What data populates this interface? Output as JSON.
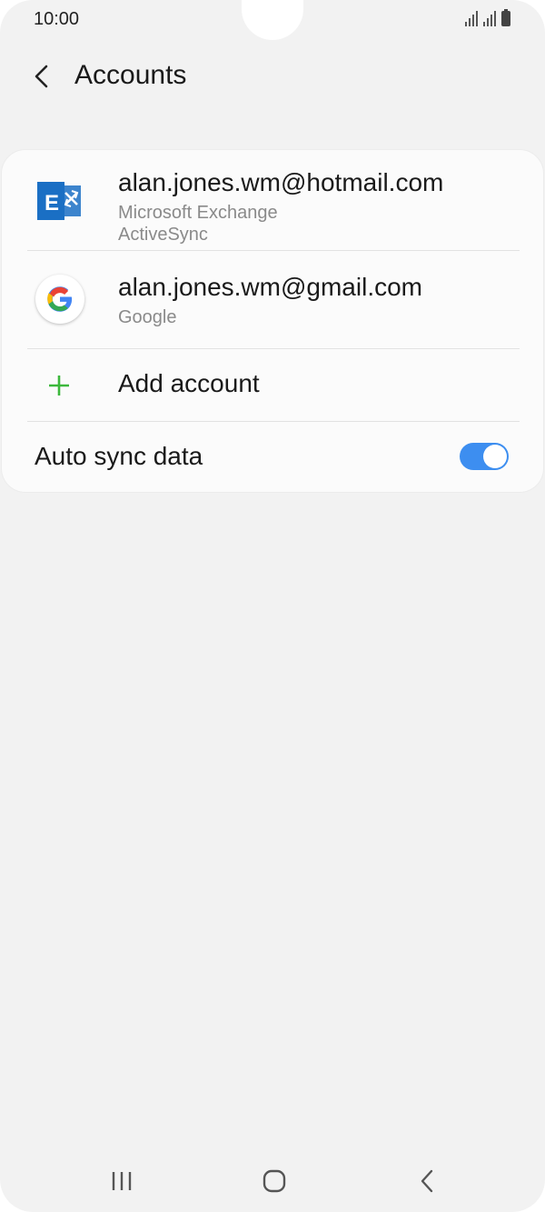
{
  "status_bar": {
    "time": "10:00"
  },
  "header": {
    "title": "Accounts",
    "back_icon": "chevron-left-icon"
  },
  "accounts": [
    {
      "email": "alan.jones.wm@hotmail.com",
      "type_line1": "Microsoft Exchange",
      "type_line2": "ActiveSync",
      "icon": "exchange-icon"
    },
    {
      "email": "alan.jones.wm@gmail.com",
      "type_line1": "Google",
      "icon": "google-icon"
    }
  ],
  "add_account": {
    "label": "Add account",
    "icon": "plus-icon"
  },
  "auto_sync": {
    "label": "Auto sync data",
    "enabled": true
  },
  "colors": {
    "accent": "#3d8ef0",
    "plus_green": "#3cb83c",
    "exchange_blue": "#1a6fc4"
  },
  "nav": {
    "recents_icon": "recents-icon",
    "home_icon": "home-icon",
    "back_icon": "back-icon"
  }
}
